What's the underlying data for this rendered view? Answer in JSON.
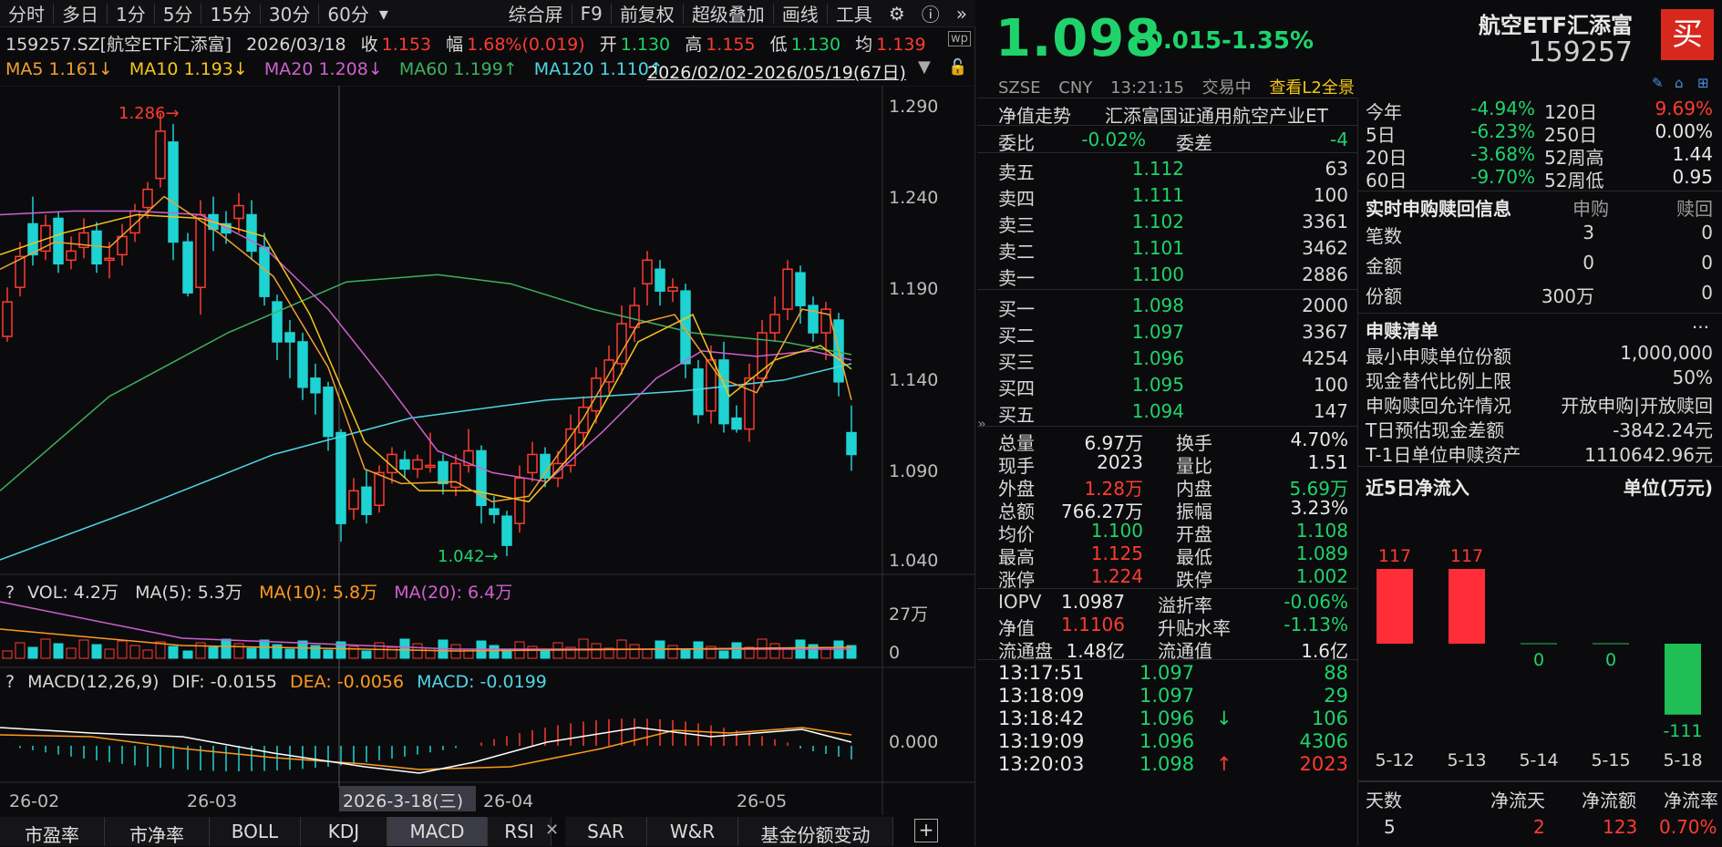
{
  "toolbar": {
    "items": [
      "分时",
      "多日",
      "1分",
      "5分",
      "15分",
      "30分",
      "60分",
      "综合屏",
      "F9",
      "前复权",
      "超级叠加",
      "画线",
      "工具"
    ]
  },
  "quote": {
    "code_name": "159257.SZ[航空ETF汇添富]",
    "date": "2026/03/18",
    "close_label": "收",
    "close": "1.153",
    "amp_label": "幅",
    "amp": "1.68%(0.019)",
    "open_label": "开",
    "open": "1.130",
    "high_label": "高",
    "high": "1.155",
    "low_label": "低",
    "low": "1.130",
    "avg_label": "均",
    "avg": "1.139"
  },
  "ma": {
    "ma5": "MA5  1.161↓",
    "ma10": "MA10  1.193↓",
    "ma20": "MA20  1.208↓",
    "ma60": "MA60  1.199↑",
    "ma120": "MA120  1.110↑",
    "range": "2026/02/02-2026/05/19(67日)"
  },
  "axes": {
    "price_ticks": [
      "1.290",
      "1.240",
      "1.190",
      "1.140",
      "1.090",
      "1.040"
    ],
    "vol_ticks": [
      "27万",
      "0"
    ],
    "macd_tick": "0.000",
    "dates": [
      "26-02",
      "26-03",
      "2026-3-18(三)",
      "26-04",
      "26-05"
    ],
    "high_mark": "1.286→",
    "low_mark": "1.042→"
  },
  "vol": {
    "q": "?",
    "label": "VOL: 4.2万",
    "ma5": "MA(5): 5.3万",
    "ma10": "MA(10): 5.8万",
    "ma20": "MA(20): 6.4万"
  },
  "macd": {
    "q": "?",
    "label": "MACD(12,26,9)",
    "dif": "DIF: -0.0155",
    "dea": "DEA: -0.0056",
    "macd": "MACD: -0.0199"
  },
  "bottom_tabs": [
    "市盈率",
    "市净率",
    "BOLL",
    "KDJ",
    "MACD",
    "RSI",
    "SAR",
    "W&R",
    "基金份额变动"
  ],
  "header": {
    "price": "1.098",
    "chg": "-0.015",
    "pct": "-1.35%",
    "name": "航空ETF汇添富",
    "code": "159257",
    "buy_btn": "买",
    "exchange": "SZSE",
    "currency": "CNY",
    "time": "13:21:15",
    "status": "交易中",
    "l2": "查看L2全景"
  },
  "nav": {
    "label": "净值走势",
    "fund": "汇添富国证通用航空产业ET"
  },
  "wb": {
    "l1": "委比",
    "v1": "-0.02%",
    "l2": "委差",
    "v2": "-4"
  },
  "asks": [
    {
      "l": "卖五",
      "p": "1.112",
      "v": "63"
    },
    {
      "l": "卖四",
      "p": "1.111",
      "v": "100"
    },
    {
      "l": "卖三",
      "p": "1.102",
      "v": "3361"
    },
    {
      "l": "卖二",
      "p": "1.101",
      "v": "3462"
    },
    {
      "l": "卖一",
      "p": "1.100",
      "v": "2886"
    }
  ],
  "bids": [
    {
      "l": "买一",
      "p": "1.098",
      "v": "2000"
    },
    {
      "l": "买二",
      "p": "1.097",
      "v": "3367"
    },
    {
      "l": "买三",
      "p": "1.096",
      "v": "4254"
    },
    {
      "l": "买四",
      "p": "1.095",
      "v": "100"
    },
    {
      "l": "买五",
      "p": "1.094",
      "v": "147"
    }
  ],
  "stats": [
    {
      "l1": "总量",
      "v1": "6.97万",
      "l2": "换手",
      "v2": "4.70%",
      "c1": "wht",
      "c2": "wht"
    },
    {
      "l1": "现手",
      "v1": "2023",
      "l2": "量比",
      "v2": "1.51",
      "c1": "wht",
      "c2": "wht"
    },
    {
      "l1": "外盘",
      "v1": "1.28万",
      "l2": "内盘",
      "v2": "5.69万",
      "c1": "red",
      "c2": "grn"
    },
    {
      "l1": "总额",
      "v1": "766.27万",
      "l2": "振幅",
      "v2": "3.23%",
      "c1": "wht",
      "c2": "wht"
    },
    {
      "l1": "均价",
      "v1": "1.100",
      "l2": "开盘",
      "v2": "1.108",
      "c1": "grn",
      "c2": "grn"
    },
    {
      "l1": "最高",
      "v1": "1.125",
      "l2": "最低",
      "v2": "1.089",
      "c1": "red",
      "c2": "grn"
    },
    {
      "l1": "涨停",
      "v1": "1.224",
      "l2": "跌停",
      "v2": "1.002",
      "c1": "red",
      "c2": "grn"
    }
  ],
  "stats2": [
    {
      "l1": "IOPV",
      "v1": "1.0987",
      "l2": "溢折率",
      "v2": "-0.06%",
      "c1": "wht",
      "c2": "grn"
    },
    {
      "l1": "净值",
      "v1": "1.1106",
      "l2": "升贴水率",
      "v2": "-1.13%",
      "c1": "red",
      "c2": "grn"
    },
    {
      "l1": "流通盘",
      "v1": "1.48亿",
      "l2": "流通值",
      "v2": "1.6亿",
      "c1": "wht",
      "c2": "wht"
    }
  ],
  "ticks": [
    {
      "t": "13:17:51",
      "p": "1.097",
      "v": "88",
      "a": "",
      "vc": "grn"
    },
    {
      "t": "13:18:09",
      "p": "1.097",
      "v": "29",
      "a": "",
      "vc": "grn"
    },
    {
      "t": "13:18:42",
      "p": "1.096",
      "v": "106",
      "a": "↓",
      "vc": "grn"
    },
    {
      "t": "13:19:09",
      "p": "1.096",
      "v": "4306",
      "a": "",
      "vc": "grn"
    },
    {
      "t": "13:20:03",
      "p": "1.098",
      "v": "2023",
      "a": "↑",
      "vc": "red"
    }
  ],
  "perf": [
    {
      "l1": "今年",
      "v1": "-4.94%",
      "l2": "120日",
      "v2": "9.69%",
      "c2": "red"
    },
    {
      "l1": "5日",
      "v1": "-6.23%",
      "l2": "250日",
      "v2": "0.00%",
      "c2": "wht"
    },
    {
      "l1": "20日",
      "v1": "-3.68%",
      "l2": "52周高",
      "v2": "1.44",
      "c2": "wht"
    },
    {
      "l1": "60日",
      "v1": "-9.70%",
      "l2": "52周低",
      "v2": "0.95",
      "c2": "wht"
    }
  ],
  "subred": {
    "title": "实时申购赎回信息",
    "h1": "申购",
    "h2": "赎回",
    "rows": [
      {
        "l": "笔数",
        "a": "3",
        "b": "0"
      },
      {
        "l": "金额",
        "a": "0",
        "b": "0"
      },
      {
        "l": "份额",
        "a": "300万",
        "b": "0"
      }
    ]
  },
  "list": {
    "title": "申赎清单",
    "more": "···",
    "rows": [
      {
        "l": "最小申赎单位份额",
        "v": "1,000,000"
      },
      {
        "l": "现金替代比例上限",
        "v": "50%"
      },
      {
        "l": "申购赎回允许情况",
        "v": "开放申购|开放赎回"
      },
      {
        "l": "T日预估现金差额",
        "v": "-3842.24元"
      },
      {
        "l": "T-1日单位申赎资产",
        "v": "1110642.96元"
      }
    ]
  },
  "flow": {
    "title": "近5日净流入",
    "unit": "单位(万元)",
    "dates": [
      "5-12",
      "5-13",
      "5-14",
      "5-15",
      "5-18"
    ],
    "labels": [
      "117",
      "117",
      "0",
      "0",
      "-111"
    ]
  },
  "flow_summary": {
    "h": [
      "天数",
      "净流天",
      "净流额",
      "净流率"
    ],
    "v": [
      "5",
      "2",
      "123",
      "0.70%"
    ]
  },
  "chart_data": [
    {
      "type": "bar",
      "title": "近5日净流入",
      "categories": [
        "5-12",
        "5-13",
        "5-14",
        "5-15",
        "5-18"
      ],
      "values": [
        117,
        117,
        0,
        0,
        -111
      ],
      "ylabel": "单位(万元)"
    }
  ]
}
